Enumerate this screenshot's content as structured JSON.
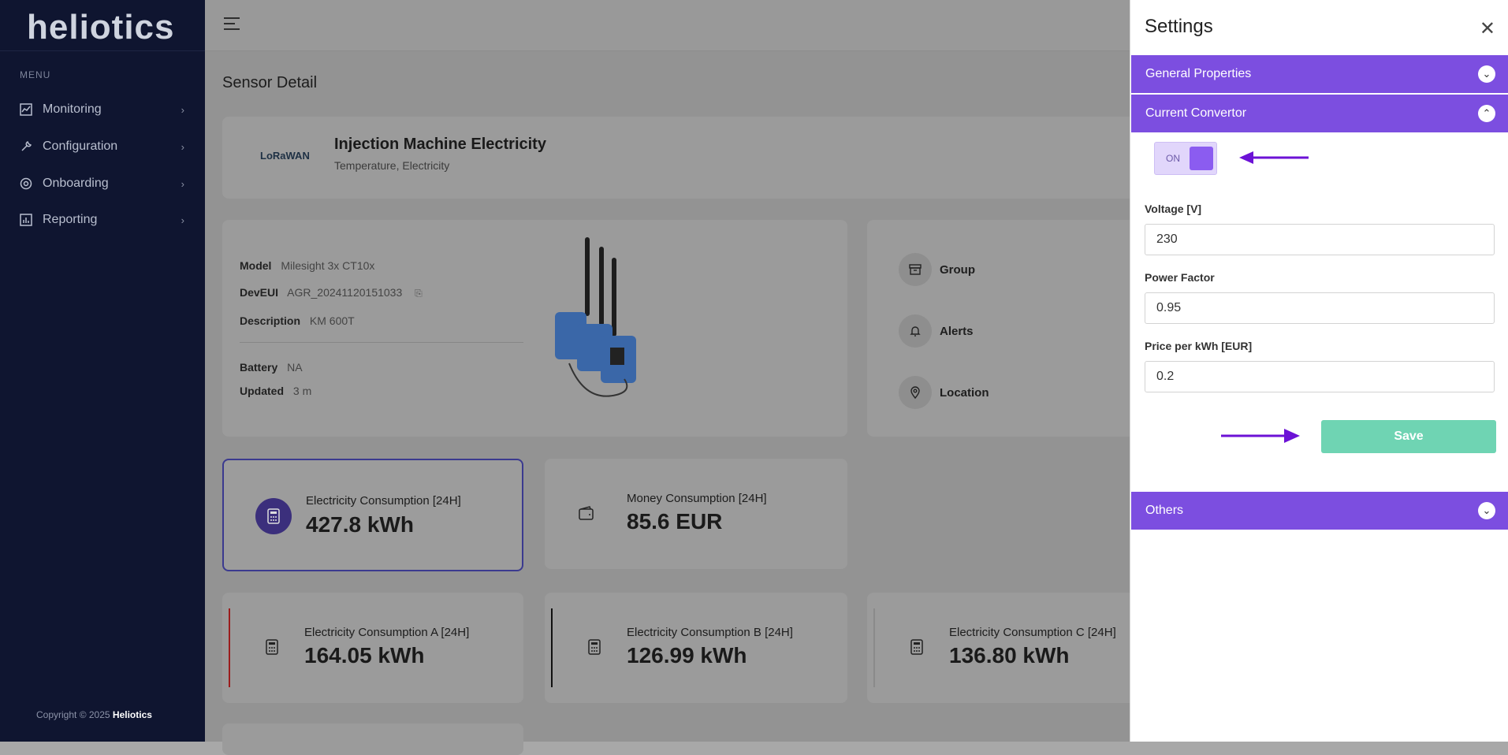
{
  "sidebar": {
    "logo": "heliotics",
    "menu_title": "MENU",
    "items": [
      {
        "label": "Monitoring",
        "icon": "chart-icon"
      },
      {
        "label": "Configuration",
        "icon": "wrench-icon"
      },
      {
        "label": "Onboarding",
        "icon": "onboarding-icon"
      },
      {
        "label": "Reporting",
        "icon": "report-icon"
      }
    ],
    "copyright_prefix": "Copyright © 2025",
    "copyright_brand": "Heliotics"
  },
  "main": {
    "page_title": "Sensor Detail",
    "device": {
      "protocol_logo": "LoRaWAN",
      "name": "Injection Machine Electricity",
      "types": "Temperature, Electricity"
    },
    "info": {
      "model_label": "Model",
      "model_value": "Milesight 3x CT10x",
      "deveui_label": "DevEUI",
      "deveui_value": "AGR_20241120151033",
      "description_label": "Description",
      "description_value": "KM 600T",
      "battery_label": "Battery",
      "battery_value": "NA",
      "updated_label": "Updated",
      "updated_value": "3 m"
    },
    "side_items": [
      {
        "label": "Group",
        "icon": "archive-icon"
      },
      {
        "label": "Alerts",
        "icon": "bell-icon"
      },
      {
        "label": "Location",
        "icon": "pin-icon"
      }
    ],
    "stats": [
      {
        "label": "Electricity Consumption [24H]",
        "value": "427.8 kWh"
      },
      {
        "label": "Money Consumption [24H]",
        "value": "85.6 EUR"
      }
    ],
    "phase_stats": [
      {
        "label": "Electricity Consumption A [24H]",
        "value": "164.05 kWh",
        "color": "#9b1c1c"
      },
      {
        "label": "Electricity Consumption B [24H]",
        "value": "126.99 kWh",
        "color": "#111111"
      },
      {
        "label": "Electricity Consumption C [24H]",
        "value": "136.80 kWh",
        "color": "#8a8a8a"
      }
    ]
  },
  "settings": {
    "title": "Settings",
    "sections": {
      "general": "General Properties",
      "current": "Current Convertor",
      "others": "Others"
    },
    "toggle_label": "ON",
    "voltage_label": "Voltage [V]",
    "voltage_value": "230",
    "power_factor_label": "Power Factor",
    "power_factor_value": "0.95",
    "price_label": "Price per kWh [EUR]",
    "price_value": "0.2",
    "save_label": "Save",
    "accent": "#7c4ee0",
    "save_color": "#6fd4b3"
  }
}
